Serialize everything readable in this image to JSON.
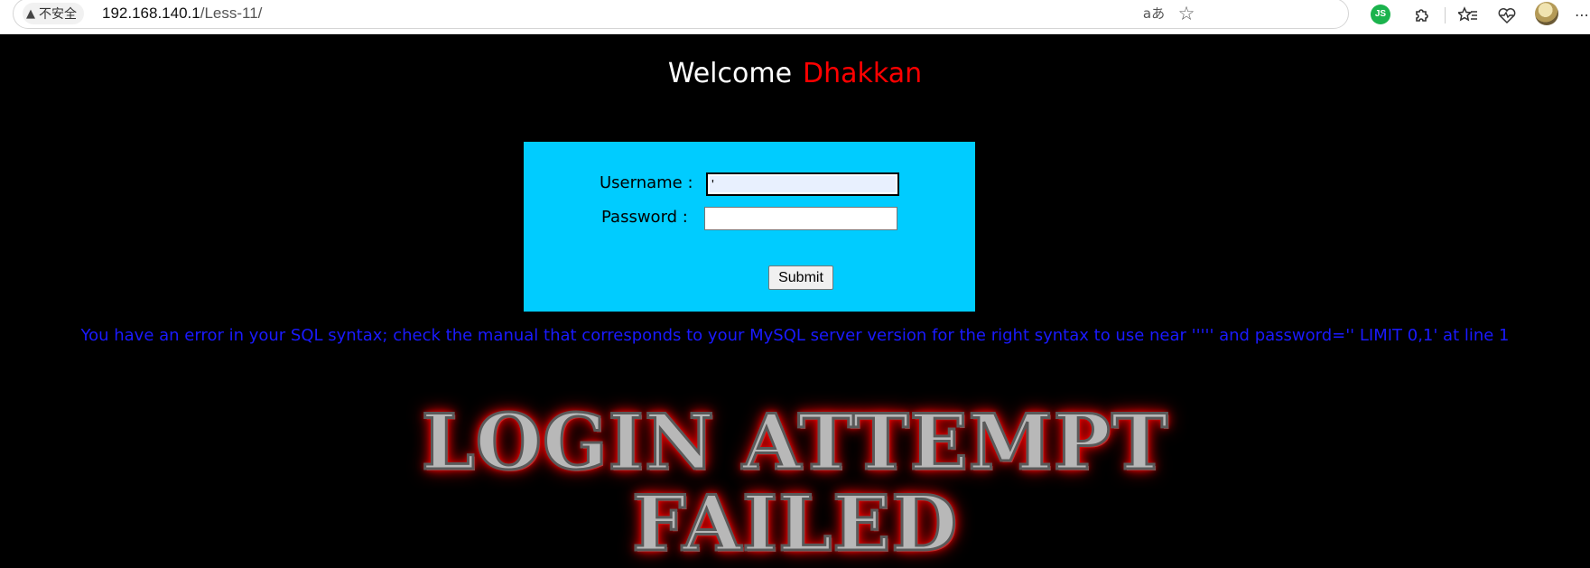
{
  "browser": {
    "security_label": "不安全",
    "url_host": "192.168.140.1",
    "url_path": "/Less-11/",
    "icons": [
      "read-aloud-icon",
      "star-icon",
      "js-extension-icon",
      "extensions-icon",
      "favorites-icon",
      "health-icon",
      "profile-avatar",
      "more-icon"
    ],
    "extension_badge": "JS",
    "read_aloud_glyph": "aあ"
  },
  "page": {
    "welcome_text": "Welcome",
    "welcome_name": "Dhakkan",
    "form": {
      "username_label": "Username :",
      "username_value": "'",
      "password_label": "Password :",
      "password_value": "",
      "submit_label": "Submit"
    },
    "error_message": "You have an error in your SQL syntax; check the manual that corresponds to your MySQL server version for the right syntax to use near ''''' and password='' LIMIT 0,1' at line 1",
    "result_line1": "LOGIN ATTEMPT",
    "result_line2": "FAILED"
  },
  "colors": {
    "background": "#000000",
    "form_bg": "#00ccff",
    "name": "#ff0000",
    "error": "#1a1aff"
  }
}
